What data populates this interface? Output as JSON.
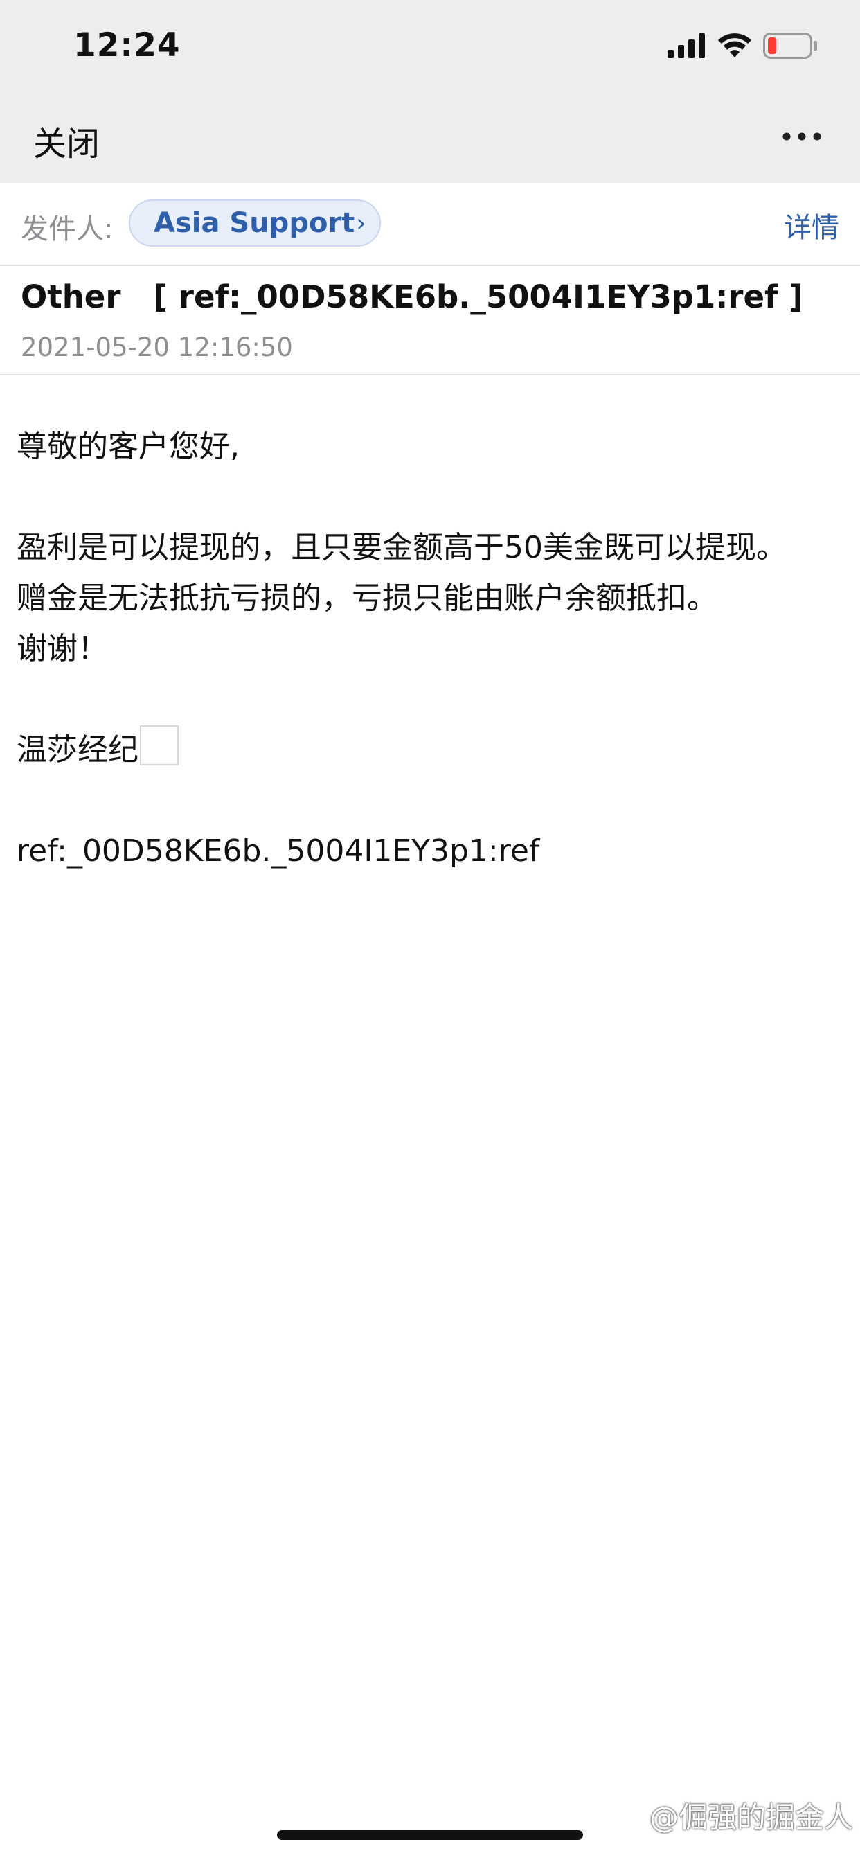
{
  "status_bar": {
    "time": "12:24",
    "icons": [
      "signal-icon",
      "wifi-icon",
      "battery-low-icon"
    ],
    "battery_color": "#ff3b30"
  },
  "nav": {
    "close_label": "关闭",
    "more_icon": "more-horizontal-icon"
  },
  "header": {
    "sender_label": "发件人:",
    "sender_name": "Asia Support",
    "sender_chevron": "›",
    "details_label": "详情",
    "accent_color": "#2f5fa8"
  },
  "email": {
    "subject": "Other   [ ref:_00D58KE6b._5004I1EY3p1:ref ]",
    "date": "2021-05-20 12:16:50",
    "body": {
      "greeting": "尊敬的客户您好,",
      "line1": "盈利是可以提现的，且只要金额高于50美金既可以提现。",
      "line2": "赠金是无法抵抗亏损的，亏损只能由账户余额抵扣。",
      "line3": "谢谢！",
      "signature": "温莎经纪",
      "ref": "ref:_00D58KE6b._5004I1EY3p1:ref"
    }
  },
  "watermark": "@倔强的掘金人"
}
